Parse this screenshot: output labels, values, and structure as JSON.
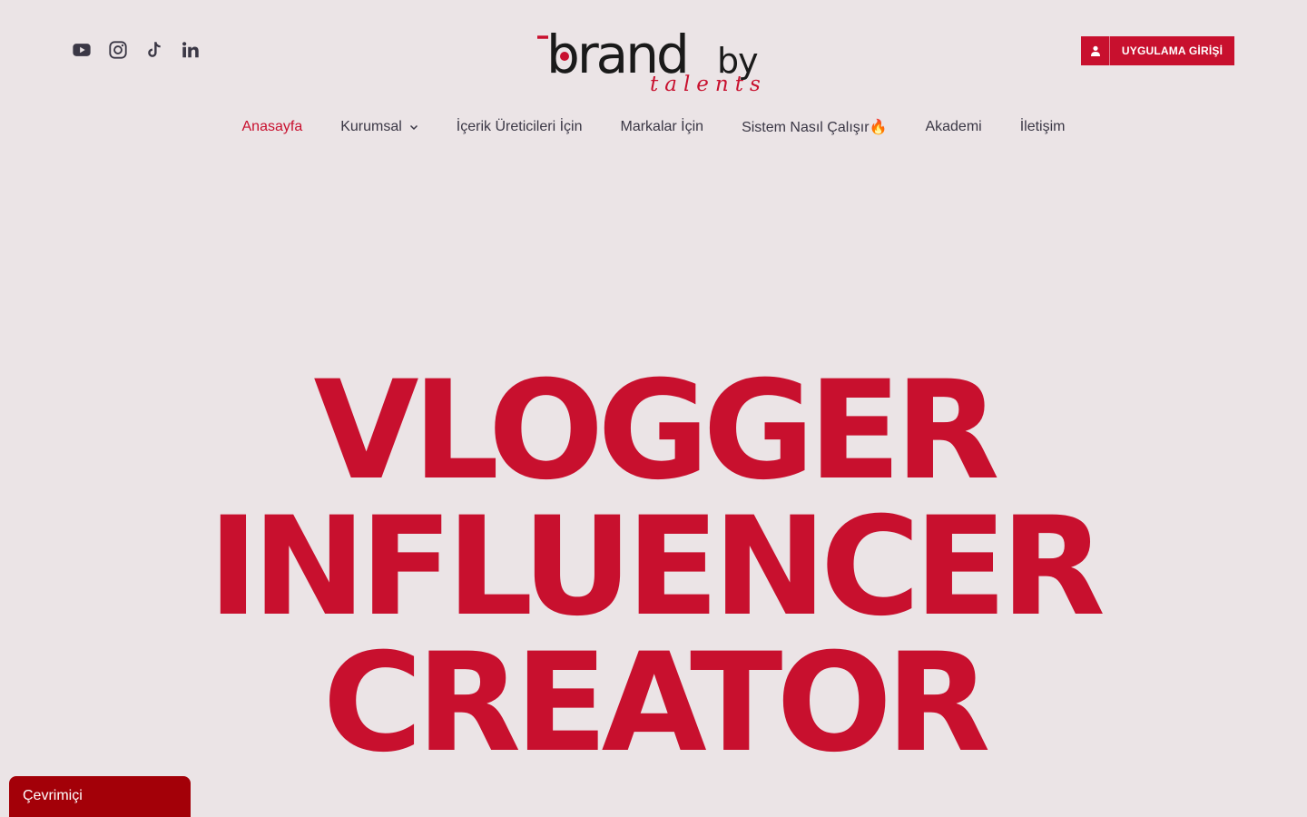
{
  "socials": [
    {
      "name": "youtube-icon"
    },
    {
      "name": "instagram-icon"
    },
    {
      "name": "tiktok-icon"
    },
    {
      "name": "linkedin-icon"
    }
  ],
  "logo": {
    "brand": "brand",
    "by": "by",
    "tagline": "talents"
  },
  "login": {
    "label": "UYGULAMA GİRİŞİ",
    "icon": "user-icon"
  },
  "nav": {
    "items": [
      {
        "label": "Anasayfa",
        "active": true
      },
      {
        "label": "Kurumsal",
        "dropdown": true
      },
      {
        "label": "İçerik Üreticileri İçin"
      },
      {
        "label": "Markalar İçin"
      },
      {
        "label": "Sistem Nasıl Çalışır🔥"
      },
      {
        "label": "Akademi"
      },
      {
        "label": "İletişim"
      }
    ]
  },
  "hero": {
    "lines": [
      "VLOGGER",
      "INFLUENCER",
      "CREATOR"
    ]
  },
  "chat": {
    "label": "Çevrimiçi"
  },
  "colors": {
    "accent": "#c8102e",
    "background": "#ebe4e6",
    "text": "#3a3745",
    "chat": "#a30008"
  }
}
